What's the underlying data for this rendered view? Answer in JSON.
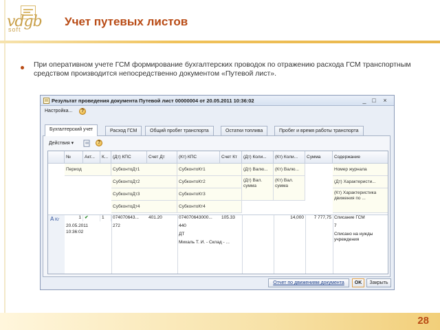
{
  "slide": {
    "title": "Учет путевых листов",
    "bullet": "При оперативном учете ГСМ формирование бухгалтерских проводок по отражению расхода ГСМ транспортным средством производится непосредственно документом «Путевой лист».",
    "page_number": "28",
    "logo_text": "vdgb",
    "logo_sub": "soft",
    "colors": {
      "title": "#b84a14",
      "accent_band": "#f0c25a"
    }
  },
  "window": {
    "title": "Результат проведения документа Путевой лист 00000004 от 20.05.2011 10:36:02",
    "controls": [
      "minimize-icon",
      "maximize-icon",
      "close-icon"
    ],
    "toolbar": {
      "settings_label": "Настройка...",
      "help_glyph": "?"
    },
    "tabs": [
      {
        "label": "Бухгалтерский учет"
      },
      {
        "label": "Расход ГСМ"
      },
      {
        "label": "Общий пробег транспорта"
      },
      {
        "label": "Остатки топлива"
      },
      {
        "label": "Пробег и время работы транспорта"
      }
    ],
    "panel_toolbar": {
      "actions_label": "Действия",
      "help_glyph": "?"
    },
    "grid": {
      "header_row1": [
        "№",
        "Акт...",
        "К...",
        "(Дт) КПС",
        "Счет Дт",
        "(Кт) КПС",
        "Счет Кт",
        "(Дт) Коли...",
        "(Кт) Коли...",
        "Сумма",
        "Содержание"
      ],
      "header_row2": [
        "Период",
        "СубконтоДт1",
        "СубконтоКт1",
        "(Дт) Валю...",
        "(Кт) Валю...",
        "Номер журнала"
      ],
      "header_row3": [
        "СубконтоДт2",
        "СубконтоКт2",
        "(Дт) Вал. сумма",
        "(Кт) Вал. сумма",
        "(Дт) Характеристи..."
      ],
      "header_row4": [
        "СубконтоДт3",
        "СубконтоКт3",
        "(Кт) Характеристика движения по ..."
      ],
      "header_row5": [
        "СубконтоДт4",
        "СубконтоКт4"
      ],
      "row": {
        "number": "1",
        "period_date": "20.05.2011",
        "period_time": "10:36:02",
        "kor": "1",
        "dt_kps": "074070643...",
        "dt_account": "401.20",
        "dt_subconto1": "272",
        "kt_kps": "074070643000...",
        "kt_account": "105.33",
        "kt_subconto1": "440",
        "kt_subconto2": "ДТ",
        "kt_subconto3": "Михаль Т. И. - Склад - ...",
        "kt_qty": "14,000",
        "amount": "7 777,75",
        "content": "Списание ГСМ",
        "journal_number": "7",
        "note": "Списано на нужды учреждения"
      }
    },
    "buttons": {
      "report": "Отчет по движениям документа",
      "ok": "OK",
      "close": "Закрыть"
    }
  }
}
